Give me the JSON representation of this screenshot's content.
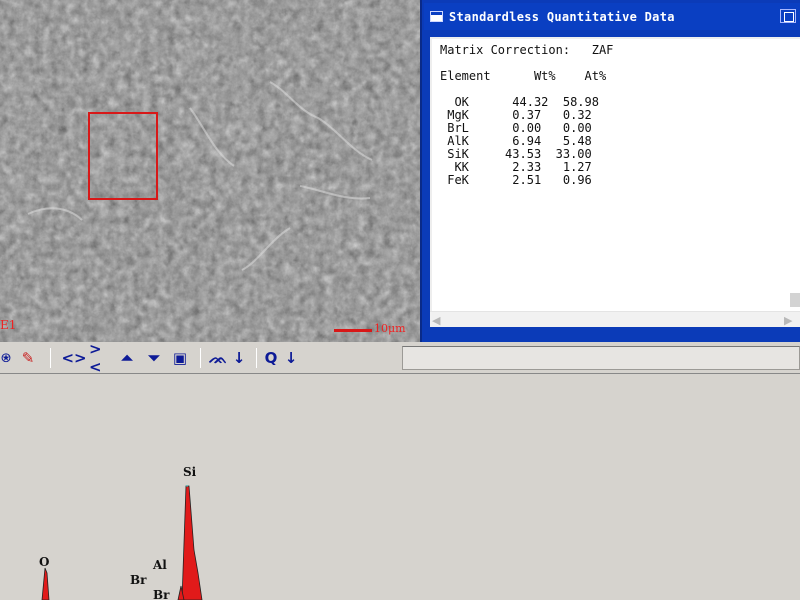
{
  "sem": {
    "scale_label": "10μm",
    "edge_label": "E1"
  },
  "window": {
    "title": "Standardless Quantitative Data",
    "matrix_label": "Matrix Correction:",
    "matrix_value": "ZAF",
    "headers": [
      "Element",
      "Wt%",
      "At%"
    ],
    "rows": [
      {
        "element": "OK",
        "wt": "44.32",
        "at": "58.98"
      },
      {
        "element": "MgK",
        "wt": "0.37",
        "at": "0.32"
      },
      {
        "element": "BrL",
        "wt": "0.00",
        "at": "0.00"
      },
      {
        "element": "AlK",
        "wt": "6.94",
        "at": "5.48"
      },
      {
        "element": "SiK",
        "wt": "43.53",
        "at": "33.00"
      },
      {
        "element": "KK",
        "wt": "2.33",
        "at": "1.27"
      },
      {
        "element": "FeK",
        "wt": "2.51",
        "at": "0.96"
      }
    ]
  },
  "toolbar": {
    "items": [
      "shield-icon",
      "pen-icon",
      "left-right-icon",
      "collapse-icon",
      "up-triangle-icon",
      "down-triangle-icon",
      "eraser-icon",
      "peaks-icon",
      "arrow-down-icon",
      "zoom-q-icon",
      "arrow-down-icon"
    ],
    "colors": {
      "icon": "#0d1a96",
      "red": "#c81e1e"
    }
  },
  "spectrum": {
    "labels": [
      "O",
      "Br",
      "Al",
      "Br",
      "Si"
    ],
    "colors": {
      "peak": "#e11a1a"
    }
  }
}
